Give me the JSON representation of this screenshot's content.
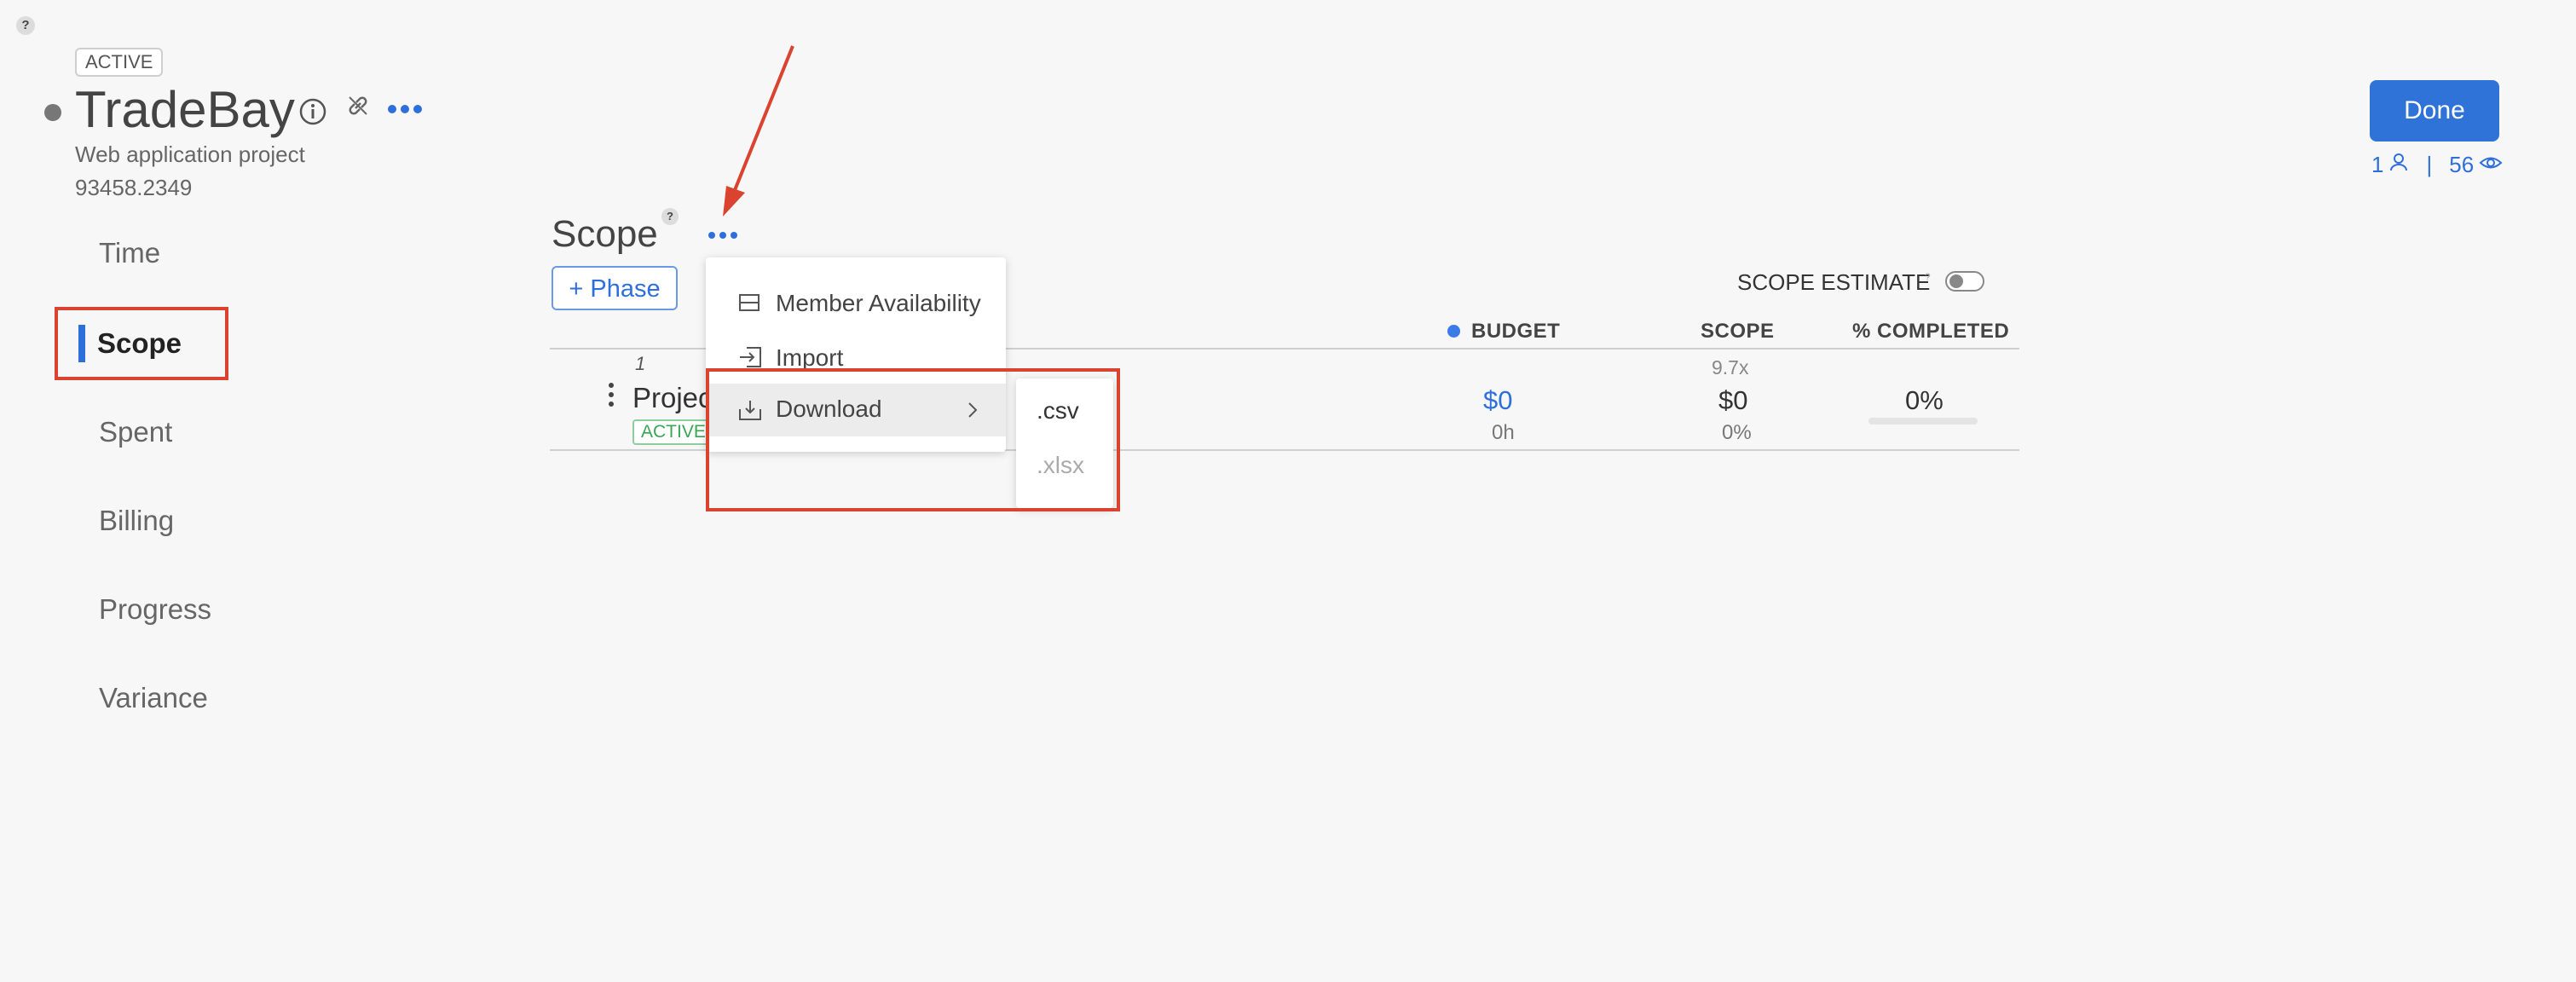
{
  "help": {
    "top_label": "?",
    "scope_label": "?",
    "estimate_label": "?"
  },
  "project": {
    "status": "ACTIVE",
    "name": "TradeBay",
    "description": "Web application project",
    "code": "93458.2349"
  },
  "header": {
    "done_label": "Done",
    "members_count": "1",
    "separator": "|",
    "viewers_count": "56"
  },
  "sidebar": {
    "items": [
      {
        "label": "Time"
      },
      {
        "label": "Scope"
      },
      {
        "label": "Spent"
      },
      {
        "label": "Billing"
      },
      {
        "label": "Progress"
      },
      {
        "label": "Variance"
      }
    ]
  },
  "scope": {
    "title": "Scope",
    "add_phase_label": "+ Phase",
    "estimate_label": "SCOPE ESTIMATE",
    "estimate_toggle_on": false
  },
  "table": {
    "headers": {
      "budget": "BUDGET",
      "scope": "SCOPE",
      "completed": "% COMPLETED"
    },
    "row": {
      "index": "1",
      "name": "Projec",
      "status": "ACTIVE",
      "budget_value": "$0",
      "budget_hours": "0h",
      "scope_multiplier": "9.7x",
      "scope_value": "$0",
      "scope_percent": "0%",
      "completed_value": "0%",
      "completed_progress": 0
    }
  },
  "menu": {
    "items": [
      {
        "label": "Member Availability",
        "icon": "calendar-icon"
      },
      {
        "label": "Import",
        "icon": "import-icon"
      },
      {
        "label": "Download",
        "icon": "download-icon"
      }
    ],
    "submenu": [
      {
        "label": ".csv"
      },
      {
        "label": ".xlsx"
      }
    ]
  },
  "colors": {
    "accent": "#2f6fdb",
    "highlight_red": "#d9432f",
    "active_green": "#3aa655",
    "budget_dot": "#3b7be8"
  }
}
